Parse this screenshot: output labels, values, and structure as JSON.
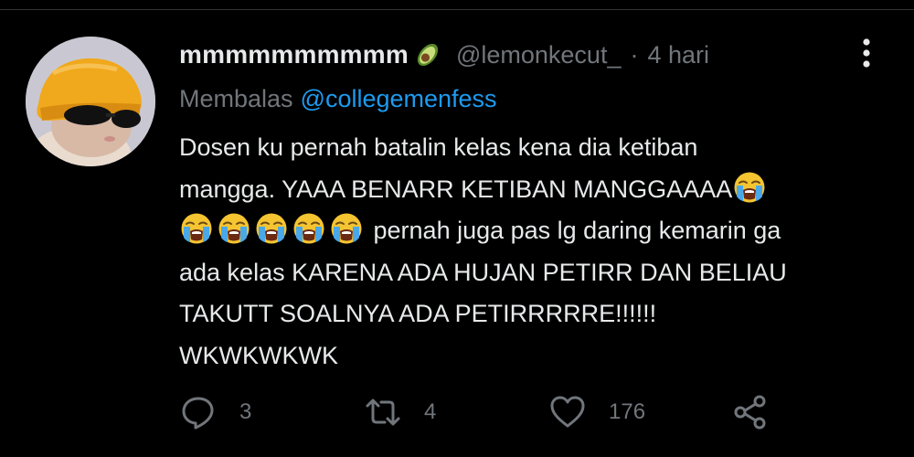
{
  "author": {
    "display_name": "mmmmmmmmmm",
    "badge_icon": "avocado-emoji",
    "handle": "@lemonkecut_",
    "separator": "·",
    "time": "4 hari"
  },
  "reply_context": {
    "prefix": "Membalas",
    "mention": "@collegemenfess"
  },
  "tweet": {
    "lines": [
      "Dosen ku pernah batalin kelas kena dia ketiban",
      "mangga. YAAA BENARR KETIBAN MANGGAAAA",
      "pernah juga pas lg daring kemarin ga",
      "ada kelas KARENA ADA HUJAN PETIRR DAN BELIAU",
      "TAKUTT SOALNYA ADA PETIRRRRRE!!!!!!",
      "WKWKWKWK"
    ],
    "emoji_name": "loudly-crying-face"
  },
  "actions": {
    "reply_count": "3",
    "retweet_count": "4",
    "like_count": "176"
  },
  "colors": {
    "background": "#000000",
    "text": "#e7e9ea",
    "secondary": "#71767b",
    "accent": "#1d9bf0"
  }
}
